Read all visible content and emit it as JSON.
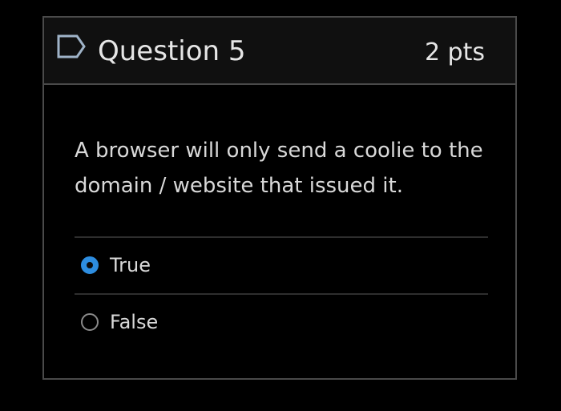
{
  "question": {
    "title": "Question 5",
    "points": "2 pts",
    "text": "A browser will only send a coolie to the domain / website that issued it.",
    "flag_icon": "flag-outline-icon"
  },
  "answers": [
    {
      "label": "True",
      "selected": true
    },
    {
      "label": "False",
      "selected": false
    }
  ],
  "colors": {
    "background": "#000000",
    "header_background": "#101010",
    "border": "#4a4a4a",
    "radio_selected": "#2d8de0",
    "text": "#d9d9d9"
  }
}
